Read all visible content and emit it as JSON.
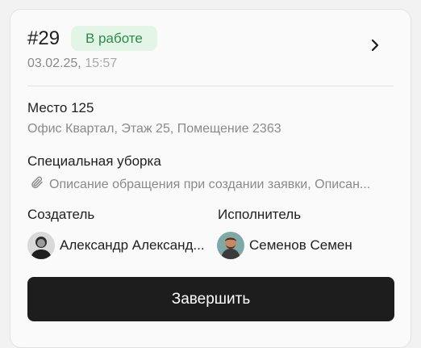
{
  "ticket": {
    "number": "#29",
    "status": "В работе",
    "date": "03.02.25,",
    "time": "15:57"
  },
  "place": {
    "title": "Место 125",
    "address": "Офис Квартал, Этаж 25, Помещение 2363"
  },
  "service": {
    "title": "Специальная уборка",
    "description": "Описание обращения при создании заявки, Описан..."
  },
  "creator": {
    "label": "Создатель",
    "name": "Александр Александ..."
  },
  "executor": {
    "label": "Исполнитель",
    "name": "Семенов Семен"
  },
  "actions": {
    "complete_label": "Завершить"
  },
  "colors": {
    "status_bg": "#e2f5e6",
    "status_text": "#2e8b48",
    "button_bg": "#1d1d1d"
  }
}
